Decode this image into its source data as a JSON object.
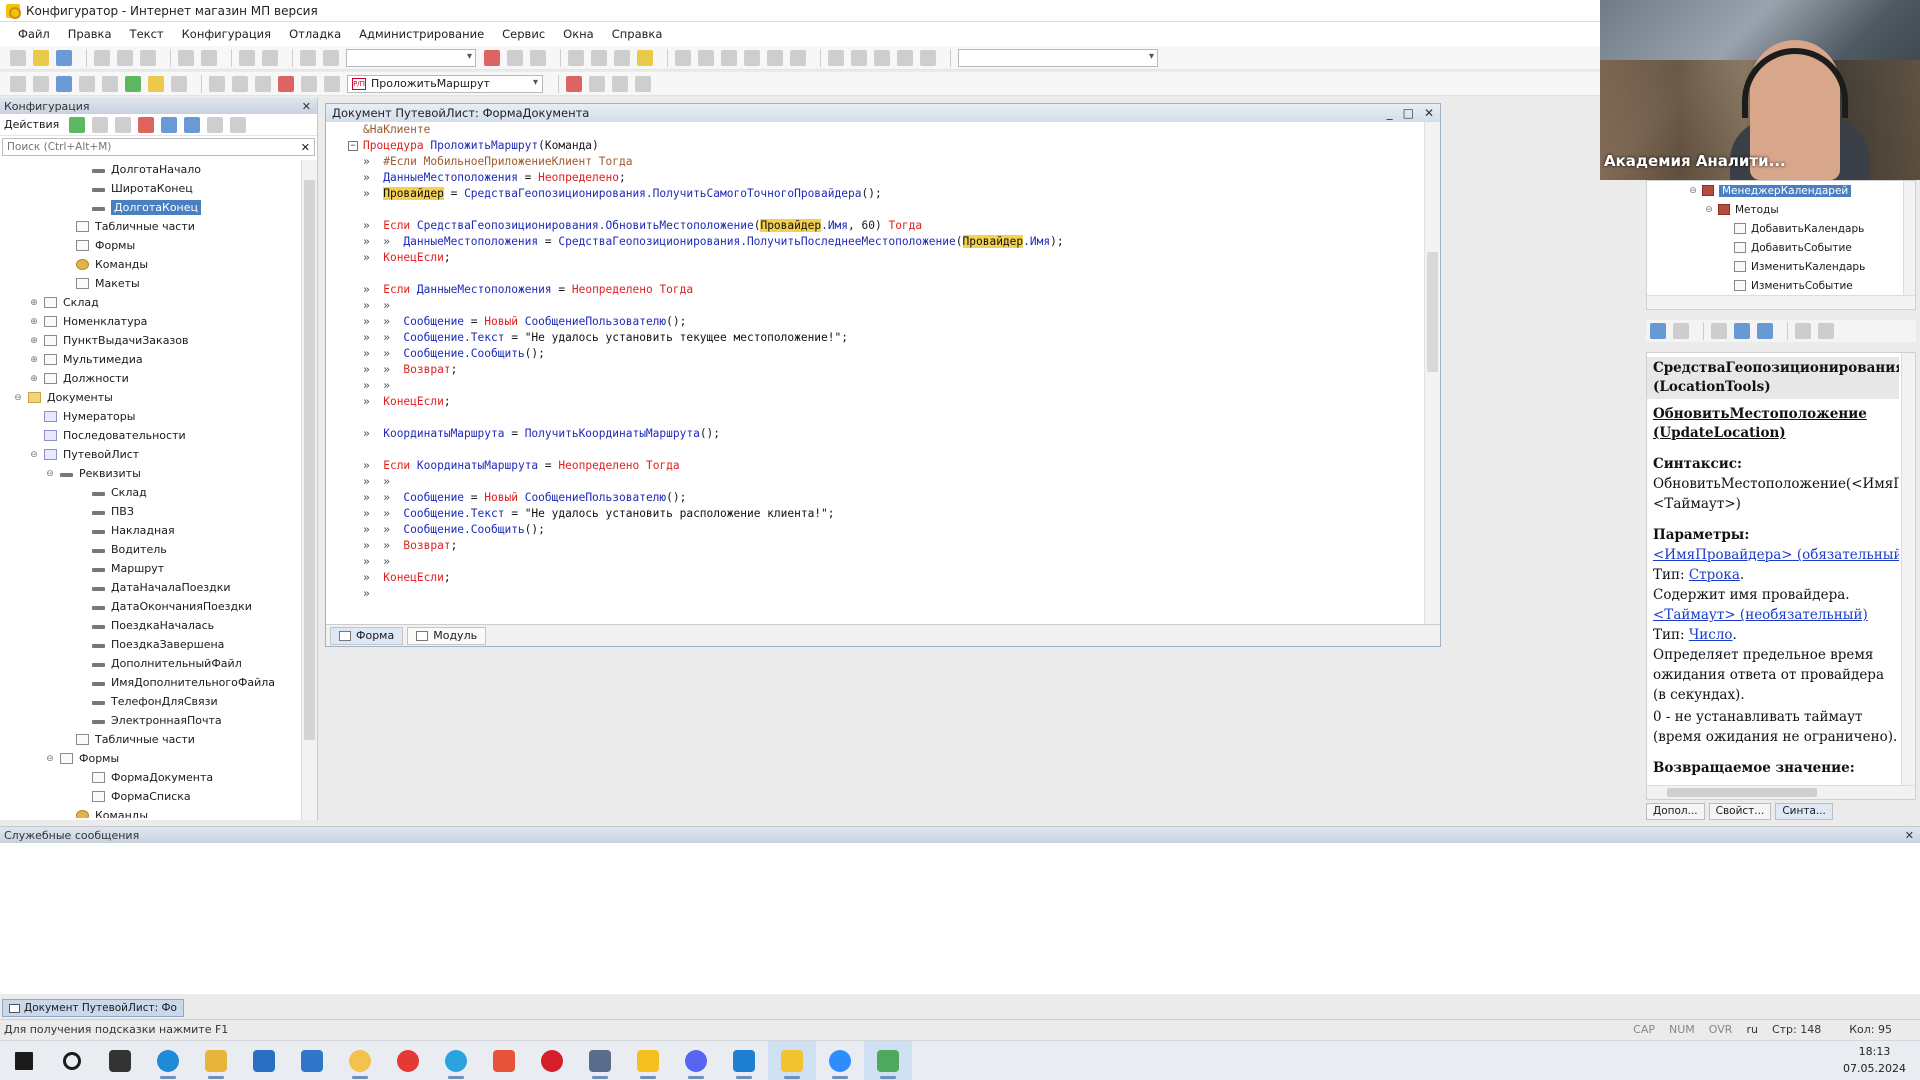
{
  "window": {
    "title": "Конфигуратор - Интернет магазин МП версия"
  },
  "menu": [
    "Файл",
    "Правка",
    "Текст",
    "Конфигурация",
    "Отладка",
    "Администрирование",
    "Сервис",
    "Окна",
    "Справка"
  ],
  "toolbar": {
    "procedure_selector": "ПроложитьМаршрут",
    "procedure_icon": "Р/П"
  },
  "left_panel": {
    "header": "Конфигурация",
    "actions_label": "Действия",
    "search_placeholder": "Поиск (Ctrl+Alt+M)",
    "tree": [
      {
        "label": "ДолготаНачало",
        "level": 4,
        "icon": "attr",
        "exp": ""
      },
      {
        "label": "ШиротаКонец",
        "level": 4,
        "icon": "attr",
        "exp": ""
      },
      {
        "label": "ДолготаКонец",
        "level": 4,
        "icon": "attr",
        "exp": "",
        "selected": true
      },
      {
        "label": "Табличные части",
        "level": 3,
        "icon": "box",
        "exp": ""
      },
      {
        "label": "Формы",
        "level": 3,
        "icon": "box",
        "exp": ""
      },
      {
        "label": "Команды",
        "level": 3,
        "icon": "gear",
        "exp": ""
      },
      {
        "label": "Макеты",
        "level": 3,
        "icon": "box",
        "exp": ""
      },
      {
        "label": "Склад",
        "level": 1,
        "icon": "box",
        "exp": "⊕"
      },
      {
        "label": "Номенклатура",
        "level": 1,
        "icon": "box",
        "exp": "⊕"
      },
      {
        "label": "ПунктВыдачиЗаказов",
        "level": 1,
        "icon": "box",
        "exp": "⊕"
      },
      {
        "label": "Мультимедиа",
        "level": 1,
        "icon": "box",
        "exp": "⊕"
      },
      {
        "label": "Должности",
        "level": 1,
        "icon": "box",
        "exp": "⊕"
      },
      {
        "label": "Документы",
        "level": 0,
        "icon": "folder",
        "exp": "⊖"
      },
      {
        "label": "Нумераторы",
        "level": 1,
        "icon": "doc",
        "exp": ""
      },
      {
        "label": "Последовательности",
        "level": 1,
        "icon": "doc",
        "exp": ""
      },
      {
        "label": "ПутевойЛист",
        "level": 1,
        "icon": "doc",
        "exp": "⊖"
      },
      {
        "label": "Реквизиты",
        "level": 2,
        "icon": "attr",
        "exp": "⊖"
      },
      {
        "label": "Склад",
        "level": 4,
        "icon": "attr",
        "exp": ""
      },
      {
        "label": "ПВЗ",
        "level": 4,
        "icon": "attr",
        "exp": ""
      },
      {
        "label": "Накладная",
        "level": 4,
        "icon": "attr",
        "exp": ""
      },
      {
        "label": "Водитель",
        "level": 4,
        "icon": "attr",
        "exp": ""
      },
      {
        "label": "Маршрут",
        "level": 4,
        "icon": "attr",
        "exp": ""
      },
      {
        "label": "ДатаНачалаПоездки",
        "level": 4,
        "icon": "attr",
        "exp": ""
      },
      {
        "label": "ДатаОкончанияПоездки",
        "level": 4,
        "icon": "attr",
        "exp": ""
      },
      {
        "label": "ПоездкаНачалась",
        "level": 4,
        "icon": "attr",
        "exp": ""
      },
      {
        "label": "ПоездкаЗавершена",
        "level": 4,
        "icon": "attr",
        "exp": ""
      },
      {
        "label": "ДополнительныйФайл",
        "level": 4,
        "icon": "attr",
        "exp": ""
      },
      {
        "label": "ИмяДополнительногоФайла",
        "level": 4,
        "icon": "attr",
        "exp": ""
      },
      {
        "label": "ТелефонДляСвязи",
        "level": 4,
        "icon": "attr",
        "exp": ""
      },
      {
        "label": "ЭлектроннаяПочта",
        "level": 4,
        "icon": "attr",
        "exp": ""
      },
      {
        "label": "Табличные части",
        "level": 3,
        "icon": "box",
        "exp": ""
      },
      {
        "label": "Формы",
        "level": 2,
        "icon": "box",
        "exp": "⊖"
      },
      {
        "label": "ФормаДокумента",
        "level": 4,
        "icon": "box",
        "exp": ""
      },
      {
        "label": "ФормаСписка",
        "level": 4,
        "icon": "box",
        "exp": ""
      },
      {
        "label": "Команды",
        "level": 3,
        "icon": "gear",
        "exp": ""
      }
    ]
  },
  "editor": {
    "title": "Документ ПутевойЛист: ФормаДокумента",
    "tabs": [
      "Форма",
      "Модуль"
    ],
    "code": [
      [
        [
          "pre",
          "&НаКлиенте"
        ]
      ],
      [
        [
          "kw",
          "Процедура"
        ],
        [
          "tx",
          " "
        ],
        [
          "id",
          "ПроложитьМаршрут"
        ],
        [
          "tx",
          "(Команда)"
        ]
      ],
      [
        [
          "tab",
          "»  "
        ],
        [
          "pre",
          "#Если МобильноеПриложениеКлиент Тогда"
        ]
      ],
      [
        [
          "tab",
          "»  "
        ],
        [
          "id",
          "ДанныеМестоположения"
        ],
        [
          "tx",
          " = "
        ],
        [
          "kw",
          "Неопределено"
        ],
        [
          "tx",
          ";"
        ]
      ],
      [
        [
          "tab",
          "»  "
        ],
        [
          "hl",
          "Провайдер"
        ],
        [
          "tx",
          " = "
        ],
        [
          "id",
          "СредстваГеопозиционирования.ПолучитьСамогоТочногоПровайдера"
        ],
        [
          "tx",
          "();"
        ]
      ],
      [],
      [
        [
          "tab",
          "»  "
        ],
        [
          "kw",
          "Если"
        ],
        [
          "tx",
          " "
        ],
        [
          "id",
          "СредстваГеопозиционирования.ОбновитьМестоположение"
        ],
        [
          "tx",
          "("
        ],
        [
          "hl",
          "Провайдер"
        ],
        [
          "id",
          ".Имя"
        ],
        [
          "tx",
          ", 60) "
        ],
        [
          "kw",
          "Тогда"
        ]
      ],
      [
        [
          "tab",
          "»  »  "
        ],
        [
          "id",
          "ДанныеМестоположения"
        ],
        [
          "tx",
          " = "
        ],
        [
          "id",
          "СредстваГеопозиционирования.ПолучитьПоследнееМестоположение"
        ],
        [
          "tx",
          "("
        ],
        [
          "hl",
          "Провайдер"
        ],
        [
          "id",
          ".Имя"
        ],
        [
          "tx",
          ");"
        ]
      ],
      [
        [
          "tab",
          "»  "
        ],
        [
          "kw",
          "КонецЕсли"
        ],
        [
          "tx",
          ";"
        ]
      ],
      [],
      [
        [
          "tab",
          "»  "
        ],
        [
          "kw",
          "Если"
        ],
        [
          "tx",
          " "
        ],
        [
          "id",
          "ДанныеМестоположения"
        ],
        [
          "tx",
          " = "
        ],
        [
          "kw",
          "Неопределено"
        ],
        [
          "tx",
          " "
        ],
        [
          "kw",
          "Тогда"
        ]
      ],
      [
        [
          "tab",
          "»  »"
        ]
      ],
      [
        [
          "tab",
          "»  »  "
        ],
        [
          "id",
          "Сообщение"
        ],
        [
          "tx",
          " = "
        ],
        [
          "kw",
          "Новый"
        ],
        [
          "tx",
          " "
        ],
        [
          "id",
          "СообщениеПользователю"
        ],
        [
          "tx",
          "();"
        ]
      ],
      [
        [
          "tab",
          "»  »  "
        ],
        [
          "id",
          "Сообщение.Текст"
        ],
        [
          "tx",
          " = "
        ],
        [
          "str",
          "\"Не удалось установить текущее местоположение!\""
        ],
        [
          "tx",
          ";"
        ]
      ],
      [
        [
          "tab",
          "»  »  "
        ],
        [
          "id",
          "Сообщение.Сообщить"
        ],
        [
          "tx",
          "();"
        ]
      ],
      [
        [
          "tab",
          "»  »  "
        ],
        [
          "kw",
          "Возврат"
        ],
        [
          "tx",
          ";"
        ]
      ],
      [
        [
          "tab",
          "»  »"
        ]
      ],
      [
        [
          "tab",
          "»  "
        ],
        [
          "kw",
          "КонецЕсли"
        ],
        [
          "tx",
          ";"
        ]
      ],
      [],
      [
        [
          "tab",
          "»  "
        ],
        [
          "id",
          "КоординатыМаршрута"
        ],
        [
          "tx",
          " = "
        ],
        [
          "id",
          "ПолучитьКоординатыМаршрута"
        ],
        [
          "tx",
          "();"
        ]
      ],
      [],
      [
        [
          "tab",
          "»  "
        ],
        [
          "kw",
          "Если"
        ],
        [
          "tx",
          " "
        ],
        [
          "id",
          "КоординатыМаршрута"
        ],
        [
          "tx",
          " = "
        ],
        [
          "kw",
          "Неопределено"
        ],
        [
          "tx",
          " "
        ],
        [
          "kw",
          "Тогда"
        ]
      ],
      [
        [
          "tab",
          "»  »"
        ]
      ],
      [
        [
          "tab",
          "»  »  "
        ],
        [
          "id",
          "Сообщение"
        ],
        [
          "tx",
          " = "
        ],
        [
          "kw",
          "Новый"
        ],
        [
          "tx",
          " "
        ],
        [
          "id",
          "СообщениеПользователю"
        ],
        [
          "tx",
          "();"
        ]
      ],
      [
        [
          "tab",
          "»  »  "
        ],
        [
          "id",
          "Сообщение.Текст"
        ],
        [
          "tx",
          " = "
        ],
        [
          "str",
          "\"Не удалось установить расположение клиента!\""
        ],
        [
          "tx",
          ";"
        ]
      ],
      [
        [
          "tab",
          "»  »  "
        ],
        [
          "id",
          "Сообщение.Сообщить"
        ],
        [
          "tx",
          "();"
        ]
      ],
      [
        [
          "tab",
          "»  »  "
        ],
        [
          "kw",
          "Возврат"
        ],
        [
          "tx",
          ";"
        ]
      ],
      [
        [
          "tab",
          "»  »"
        ]
      ],
      [
        [
          "tab",
          "»  "
        ],
        [
          "kw",
          "КонецЕсли"
        ],
        [
          "tx",
          ";"
        ]
      ],
      [
        [
          "tab",
          "»  "
        ]
      ]
    ]
  },
  "webcam": {
    "caption": "Академия Аналити..."
  },
  "right_tree": [
    {
      "label": "МенеджерКалендарей",
      "level": 0,
      "exp": "⊖",
      "icon": "red",
      "selected": true
    },
    {
      "label": "Методы",
      "level": 1,
      "exp": "⊖",
      "icon": "red"
    },
    {
      "label": "ДобавитьКалендарь",
      "level": 2,
      "exp": "",
      "icon": "box"
    },
    {
      "label": "ДобавитьСобытие",
      "level": 2,
      "exp": "",
      "icon": "box"
    },
    {
      "label": "ИзменитьКалендарь",
      "level": 2,
      "exp": "",
      "icon": "box"
    },
    {
      "label": "ИзменитьСобытие",
      "level": 2,
      "exp": "",
      "icon": "box"
    }
  ],
  "help": {
    "object_title": "СредстваГеопозиционирования (LocationTools)",
    "method_title": "ОбновитьМестоположение (UpdateLocation)",
    "syntax_label": "Синтаксис:",
    "syntax_line1": "ОбновитьМестоположение(<ИмяП",
    "syntax_line2": "<Таймаут>)",
    "params_label": "Параметры:",
    "param1_name": "<ИмяПровайдера> (обязательный)",
    "param1_type_label": "Тип: ",
    "param1_type": "Строка",
    "param1_desc": "Содержит имя провайдера.",
    "param2_name": "<Таймаут> (необязательный)",
    "param2_type_label": "Тип: ",
    "param2_type": "Число",
    "param2_desc": "Определяет предельное время ожидания ответа от провайдера (в секундах).",
    "param2_note": "0 - не устанавливать таймаут (время ожидания не ограничено).",
    "return_label": "Возвращаемое значение:"
  },
  "right_tabs": [
    "Допол...",
    "Свойст...",
    "Синта..."
  ],
  "messages": {
    "header": "Служебные сообщения"
  },
  "window_tab": "Документ ПутевойЛист: Фо",
  "status": {
    "hint": "Для получения подсказки нажмите F1",
    "cap": "CAP",
    "num": "NUM",
    "ovr": "OVR",
    "lang": "ru",
    "line": "Стр: 148",
    "col": "Кол: 95"
  },
  "clock": {
    "time": "18:13",
    "date": "07.05.2024"
  },
  "taskbar": [
    {
      "name": "start",
      "color": "#1b1b1b",
      "running": false
    },
    {
      "name": "search",
      "color": "#1b1b1b",
      "running": false
    },
    {
      "name": "task-view",
      "color": "#333333",
      "running": false
    },
    {
      "name": "edge",
      "color": "#1f8ad8",
      "running": true
    },
    {
      "name": "explorer",
      "color": "#e8b53a",
      "running": true
    },
    {
      "name": "store",
      "color": "#2b6fc2",
      "running": false
    },
    {
      "name": "mail",
      "color": "#2f76c8",
      "running": false
    },
    {
      "name": "yandex-browser",
      "color": "#f2c14e",
      "running": true
    },
    {
      "name": "yandex",
      "color": "#e53935",
      "running": false
    },
    {
      "name": "telegram",
      "color": "#2aa3e0",
      "running": true
    },
    {
      "name": "anydesk",
      "color": "#e8533c",
      "running": false
    },
    {
      "name": "opera",
      "color": "#d21f2a",
      "running": false
    },
    {
      "name": "ssms",
      "color": "#5a6b8c",
      "running": true
    },
    {
      "name": "1c-enterprise",
      "color": "#f4c020",
      "running": true
    },
    {
      "name": "discord",
      "color": "#5865f2",
      "running": true
    },
    {
      "name": "vscode",
      "color": "#1e7fd0",
      "running": true
    },
    {
      "name": "1c-configurator",
      "color": "#f2c230",
      "running": true,
      "active": true
    },
    {
      "name": "zoom",
      "color": "#2d8cff",
      "running": true
    },
    {
      "name": "obs",
      "color": "#4ea85f",
      "running": true,
      "active": true
    }
  ]
}
